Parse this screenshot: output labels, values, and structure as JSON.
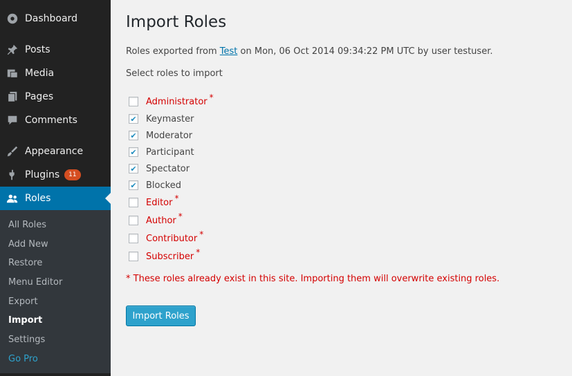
{
  "sidebar": {
    "items": [
      {
        "label": "Dashboard",
        "icon": "dashboard-icon"
      },
      {
        "label": "Posts",
        "icon": "pin-icon"
      },
      {
        "label": "Media",
        "icon": "media-icon"
      },
      {
        "label": "Pages",
        "icon": "pages-icon"
      },
      {
        "label": "Comments",
        "icon": "comment-icon"
      },
      {
        "label": "Appearance",
        "icon": "brush-icon"
      },
      {
        "label": "Plugins",
        "icon": "plugin-icon",
        "badge": "11"
      },
      {
        "label": "Roles",
        "icon": "users-icon"
      }
    ],
    "submenu": [
      "All Roles",
      "Add New",
      "Restore",
      "Menu Editor",
      "Export",
      "Import",
      "Settings",
      "Go Pro"
    ]
  },
  "main": {
    "title": "Import Roles",
    "export_prefix": "Roles exported from ",
    "export_link": "Test",
    "export_suffix": " on Mon, 06 Oct 2014 09:34:22 PM UTC by user testuser.",
    "select_text": "Select roles to import",
    "roles": [
      {
        "label": "Administrator",
        "checked": false,
        "exists": true
      },
      {
        "label": "Keymaster",
        "checked": true,
        "exists": false
      },
      {
        "label": "Moderator",
        "checked": true,
        "exists": false
      },
      {
        "label": "Participant",
        "checked": true,
        "exists": false
      },
      {
        "label": "Spectator",
        "checked": true,
        "exists": false
      },
      {
        "label": "Blocked",
        "checked": true,
        "exists": false
      },
      {
        "label": "Editor",
        "checked": false,
        "exists": true
      },
      {
        "label": "Author",
        "checked": false,
        "exists": true
      },
      {
        "label": "Contributor",
        "checked": false,
        "exists": true
      },
      {
        "label": "Subscriber",
        "checked": false,
        "exists": true
      }
    ],
    "star": "*",
    "warning": "* These roles already exist in this site. Importing them will overwrite existing roles.",
    "button": "Import Roles"
  },
  "colors": {
    "accent": "#0073aa",
    "button": "#2ea2cc",
    "warning": "#d40000",
    "sidebar": "#222222"
  }
}
